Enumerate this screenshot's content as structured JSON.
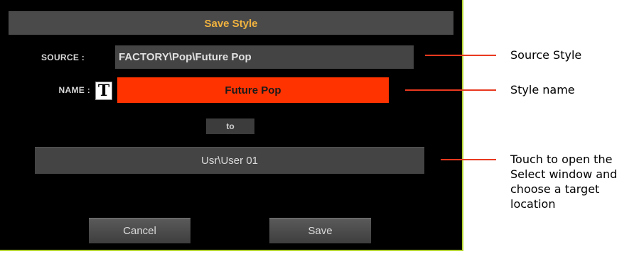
{
  "dialog": {
    "title": "Save Style",
    "source_label": "SOURCE :",
    "source_value": "FACTORY\\Pop\\Future Pop",
    "name_label": "NAME :",
    "name_icon": "T",
    "name_value": "Future Pop",
    "to_label": "to",
    "target_value": "Usr\\User 01",
    "cancel_label": "Cancel",
    "save_label": "Save"
  },
  "callouts": {
    "source": "Source Style",
    "name": "Style name",
    "target_lines": [
      "Touch to open the",
      "Select window and",
      "choose a target",
      "location"
    ]
  },
  "colors": {
    "title_text": "#f0b23f",
    "name_field_bg": "#ff3300",
    "dialog_border": "#b5d334",
    "leader_line": "#e8391f"
  }
}
